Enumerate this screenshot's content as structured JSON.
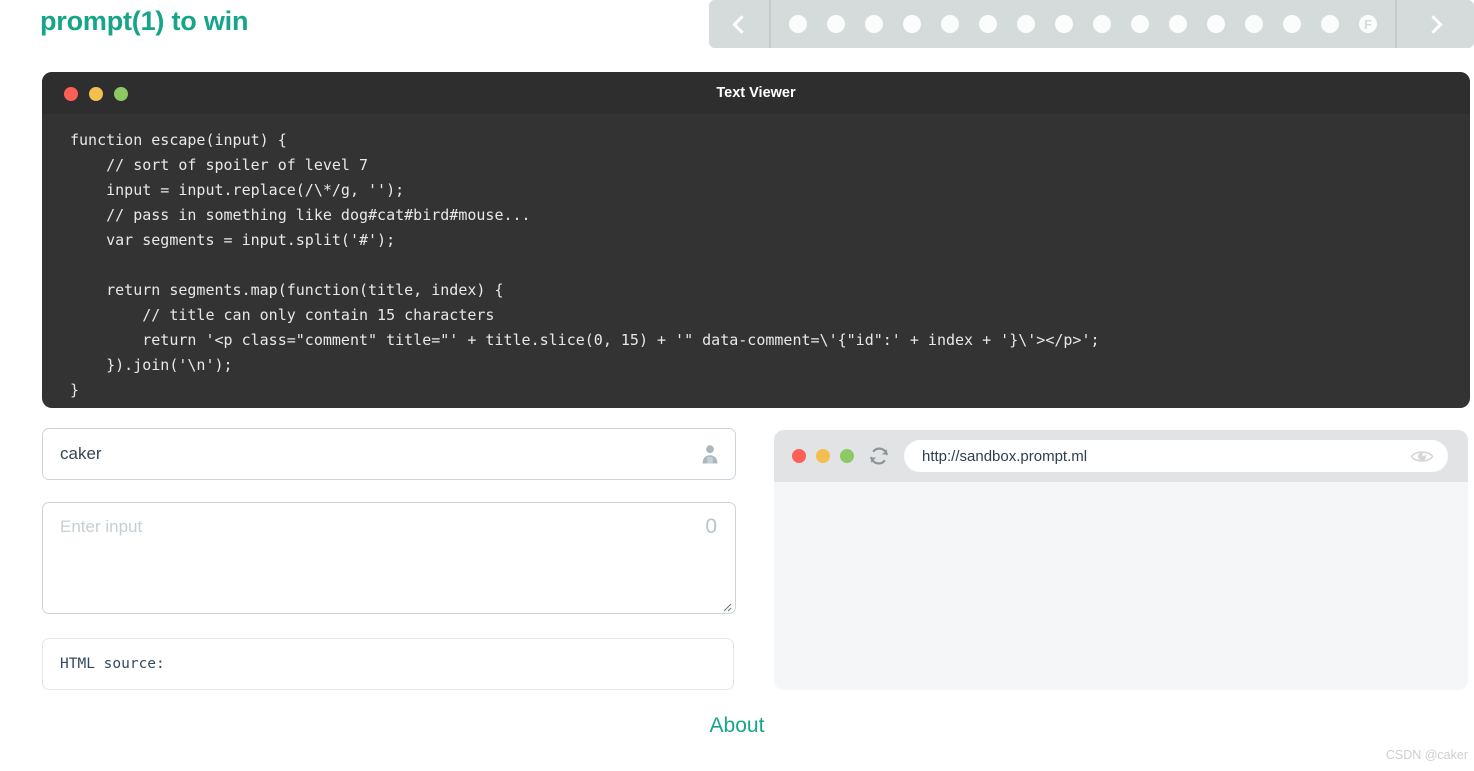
{
  "header": {
    "brand": "prompt(1) to win",
    "nav": {
      "prev_label": "‹",
      "next_label": "›",
      "prev_icon": "chevron-left-icon",
      "next_icon": "chevron-right-icon",
      "dots": [
        "",
        "",
        "",
        "",
        "",
        "",
        "",
        "",
        "",
        "",
        "",
        "",
        "",
        "",
        "",
        "F"
      ]
    }
  },
  "viewer": {
    "title": "Text Viewer",
    "traffic_lights": [
      "#ff5f57",
      "#f5bf4f",
      "#8cc965"
    ],
    "code": "function escape(input) {\n    // sort of spoiler of level 7\n    input = input.replace(/\\*/g, '');\n    // pass in something like dog#cat#bird#mouse...\n    var segments = input.split('#');\n\n    return segments.map(function(title, index) {\n        // title can only contain 15 characters\n        return '<p class=\"comment\" title=\"' + title.slice(0, 15) + '\" data-comment=\\'{\"id\":' + index + '}\\'></p>';\n    }).join('\\n');\n}"
  },
  "form": {
    "user_field": {
      "value": "caker",
      "icon": "person-icon"
    },
    "input_area": {
      "placeholder": "Enter input",
      "value": "",
      "char_count": "0"
    },
    "html_source": {
      "label": "HTML source:"
    }
  },
  "browser": {
    "url": "http://sandbox.prompt.ml",
    "refresh_icon": "refresh-icon",
    "eye_icon": "eye-icon",
    "traffic_lights": [
      "#ff5f57",
      "#f5bf4f",
      "#8cc965"
    ]
  },
  "footer": {
    "about": "About",
    "watermark": "CSDN @caker"
  },
  "colors": {
    "accent": "#17a589",
    "nav_bg": "#d5dbdb",
    "viewer_bg": "#333333",
    "viewer_title_bg": "#2e2e2e",
    "browser_bar_bg": "#e2e3e4",
    "browser_view_bg": "#f5f6f7"
  }
}
